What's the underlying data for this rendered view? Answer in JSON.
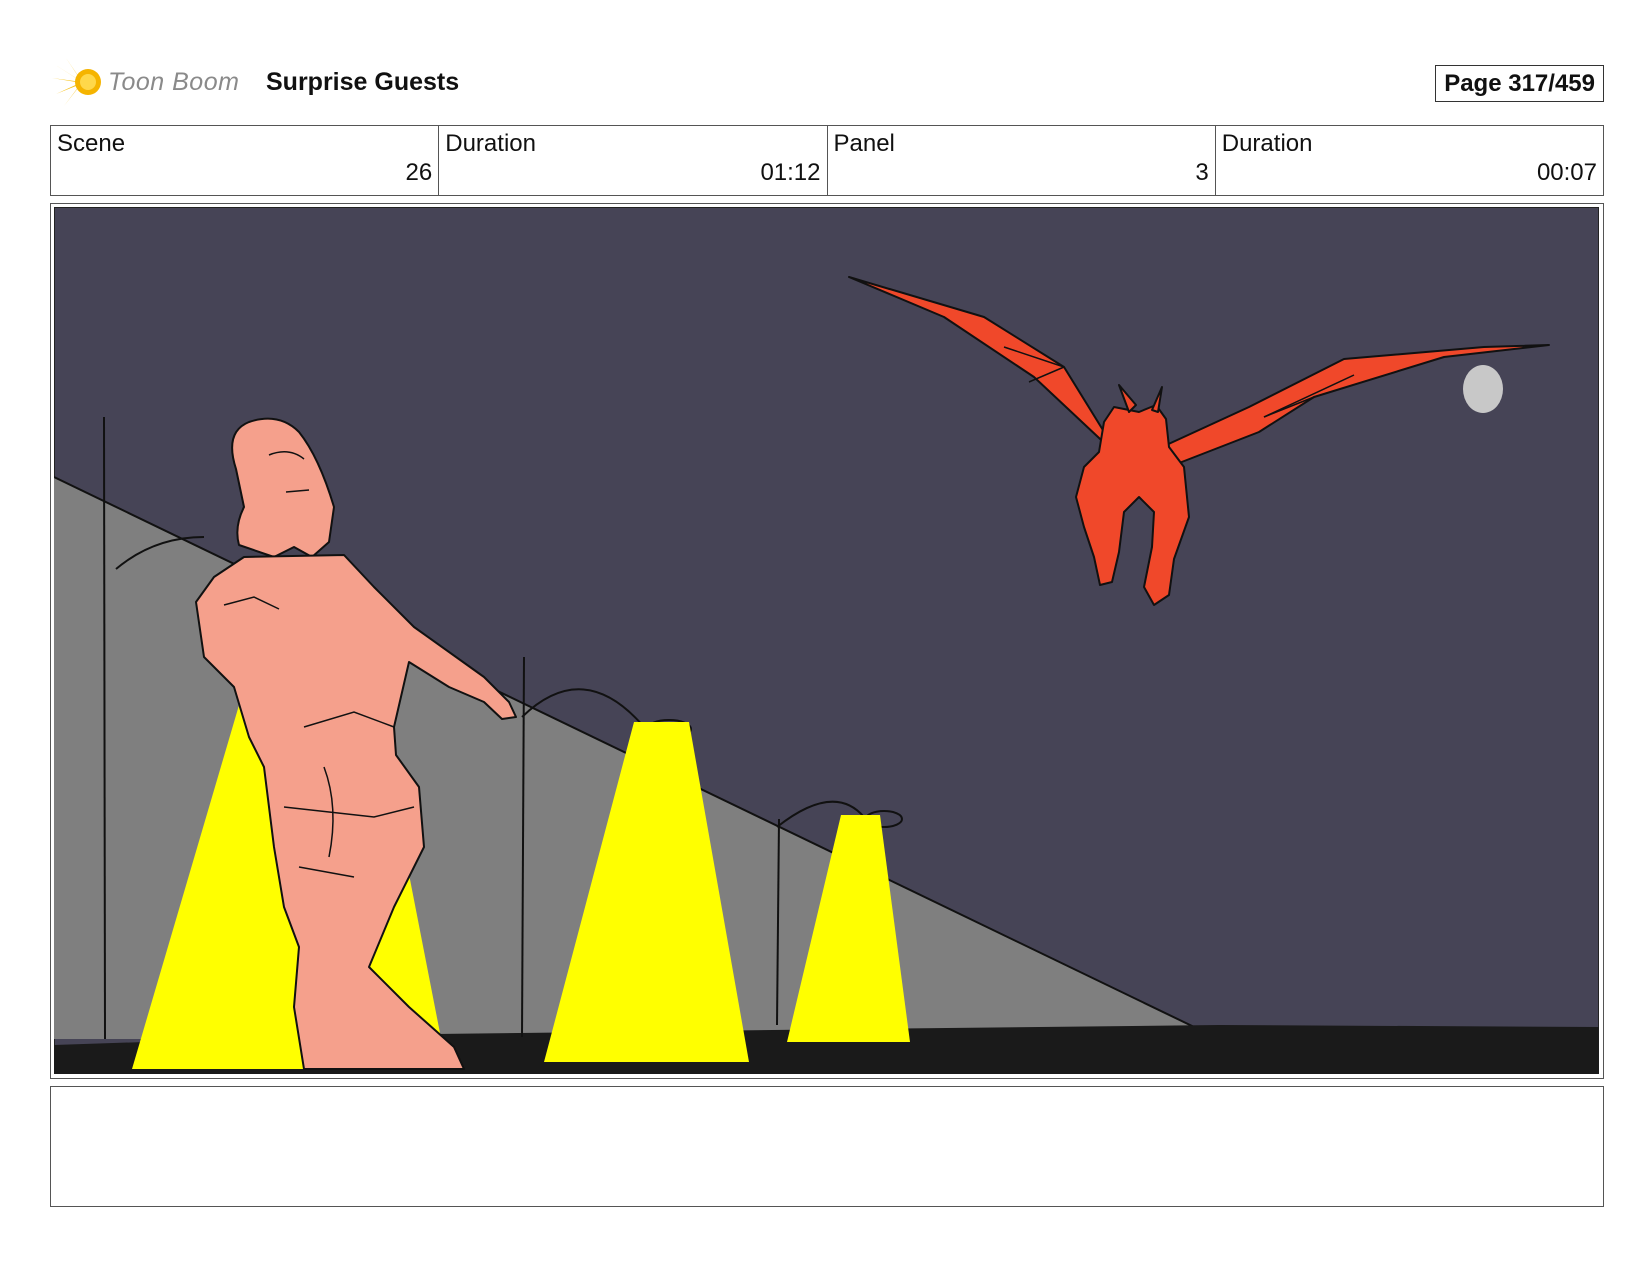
{
  "header": {
    "logo_text": "Toon Boom",
    "project_title": "Surprise Guests",
    "page_indicator": "Page 317/459"
  },
  "info": {
    "scene": {
      "label": "Scene",
      "value": "26"
    },
    "scene_duration": {
      "label": "Duration",
      "value": "01:12"
    },
    "panel": {
      "label": "Panel",
      "value": "3"
    },
    "panel_duration": {
      "label": "Duration",
      "value": "00:07"
    }
  },
  "colors": {
    "sky": "#464456",
    "wall": "#7f7f7f",
    "ground": "#1a1a1a",
    "light_cone": "#ffff00",
    "woman_skin": "#f5a08c",
    "bat_creature": "#f0482a",
    "moon": "#c8c8c8"
  },
  "icons": {
    "logo": "toon-boom-starburst-icon"
  },
  "notes": ""
}
